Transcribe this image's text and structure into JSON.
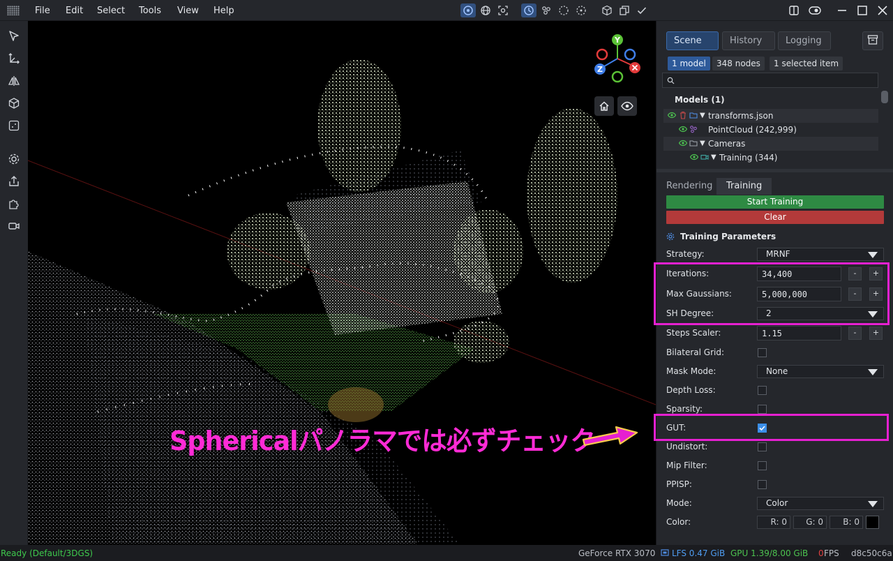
{
  "menubar": {
    "items": [
      "File",
      "Edit",
      "Select",
      "Tools",
      "View",
      "Help"
    ]
  },
  "scene_panel": {
    "tabs": [
      "Scene",
      "History",
      "Logging"
    ],
    "chips": [
      "1 model",
      "348 nodes",
      "1 selected item"
    ],
    "search_placeholder": "",
    "models_header": "Models (1)",
    "tree": [
      {
        "label": "transforms.json"
      },
      {
        "label": "PointCloud (242,999)"
      },
      {
        "label": "Cameras"
      },
      {
        "label": "Training (344)"
      }
    ]
  },
  "training_panel": {
    "tabs": [
      "Rendering",
      "Training"
    ],
    "start_label": "Start Training",
    "clear_label": "Clear",
    "params_header": "Training Parameters",
    "strategy": {
      "label": "Strategy:",
      "value": "MRNF"
    },
    "iterations": {
      "label": "Iterations:",
      "value": "34,400"
    },
    "max_gaussians": {
      "label": "Max Gaussians:",
      "value": "5,000,000"
    },
    "sh_degree": {
      "label": "SH Degree:",
      "value": "2"
    },
    "steps_scaler": {
      "label": "Steps Scaler:",
      "value": "1.15"
    },
    "bilateral_grid": {
      "label": "Bilateral Grid:",
      "checked": false
    },
    "mask_mode": {
      "label": "Mask Mode:",
      "value": "None"
    },
    "depth_loss": {
      "label": "Depth Loss:",
      "checked": false
    },
    "sparsity": {
      "label": "Sparsity:",
      "checked": false
    },
    "gut": {
      "label": "GUT:",
      "checked": true
    },
    "undistort": {
      "label": "Undistort:",
      "checked": false
    },
    "mip_filter": {
      "label": "Mip Filter:",
      "checked": false
    },
    "ppisp": {
      "label": "PPISP:",
      "checked": false
    },
    "mode": {
      "label": "Mode:",
      "value": "Color"
    },
    "color": {
      "label": "Color:",
      "r": "R: 0",
      "g": "G: 0",
      "b": "B: 0"
    },
    "minus": "-",
    "plus": "+"
  },
  "viewport": {
    "annotation": "Sphericalパノラマでは必ずチェック",
    "gizmo": {
      "y": "Y",
      "z": "Z"
    }
  },
  "status": {
    "ready": "Ready (Default/3DGS)",
    "gpu_name": "GeForce RTX 3070",
    "lfs": "LFS 0.47 GiB",
    "gpu_mem": "GPU 1.39/8.00 GiB",
    "fps_value": "0",
    "fps_unit": "FPS",
    "hash": "d8c50c6a"
  },
  "colors": {
    "accent": "#3b8ee8",
    "highlight": "#e620d1",
    "start_green": "#2e8a43",
    "clear_red": "#b33a3a"
  }
}
